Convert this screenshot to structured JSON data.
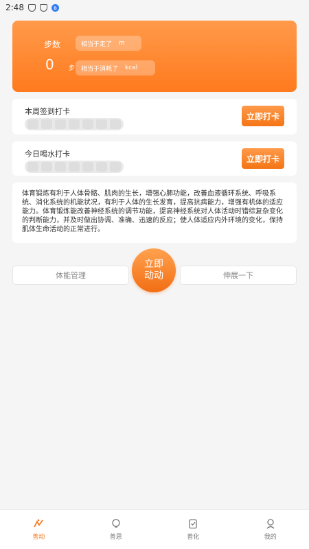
{
  "status": {
    "time": "2:48"
  },
  "hero": {
    "steps_label": "步数",
    "steps_value": "0",
    "steps_unit": "步",
    "distance_text": "相当于走了",
    "distance_unit": "m",
    "calorie_text": "相当于消耗了",
    "calorie_unit": "kcal"
  },
  "week_card": {
    "title": "本周签到打卡",
    "button": "立即打卡",
    "days": 7
  },
  "water_card": {
    "title": "今日喝水打卡",
    "button": "立即打卡",
    "days": 7
  },
  "info_text": "体育锻炼有利于人体骨骼、肌肉的生长，增强心肺功能，改善血液循环系统、呼吸系统、消化系统的机能状况，有利于人体的生长发育，提高抗病能力，增强有机体的适应能力。体育锻炼能改善神经系统的调节功能，提高神经系统对人体活动时错综复杂变化的判断能力，并及时做出协调、准确、迅速的反应；使人体适应内外环境的变化，保持肌体生命活动的正常进行。",
  "actions": {
    "left": "体能管理",
    "center": "立即\n动动",
    "right": "伸展一下"
  },
  "tabs": [
    {
      "label": "善动",
      "icon": "activity-icon",
      "active": true
    },
    {
      "label": "善思",
      "icon": "bulb-icon",
      "active": false
    },
    {
      "label": "善化",
      "icon": "clipboard-icon",
      "active": false
    },
    {
      "label": "我的",
      "icon": "user-icon",
      "active": false
    }
  ],
  "colors": {
    "accent": "#f57a1e",
    "accent_light": "#ff9a4a"
  }
}
